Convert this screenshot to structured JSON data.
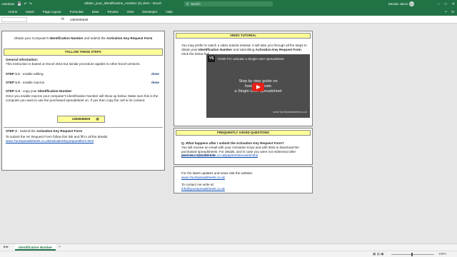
{
  "window": {
    "autosave": "AutoSave",
    "title": "obtain_your_identification_number (2).xlsm  -  Excel",
    "search_placeholder": "Search",
    "user": "Damian Jancic",
    "user_initials": "DJ"
  },
  "ribbon": {
    "tabs": [
      "Home",
      "Insert",
      "Page Layout",
      "Formulas",
      "Data",
      "Review",
      "View",
      "Developer",
      "Help"
    ]
  },
  "formula_bar": {
    "fx": "fx",
    "value": "1353635625"
  },
  "left_panel": {
    "intro_pre": "Obtain your Computer's ",
    "intro_b1": "Identification Number",
    "intro_mid": " and submit the ",
    "intro_b2": "Activation Key Request Form",
    "steps_header": "FOLLOW THESE STEPS",
    "general_title": "General information:",
    "general_text": "This instruction is based on Excel 2016 but similar procedure applies to other Excel versions.",
    "step_1_1_label": "STEP 1-1",
    "step_1_1_text": " - enable editing",
    "step_1_1_status": "done",
    "step_1_2_label": "STEP 1-2",
    "step_1_2_text": " - enable macros",
    "step_1_2_status": "done",
    "step_1_3_label": "STEP 1-3",
    "step_1_3_text_pre": " - copy your ",
    "step_1_3_text_b": "Identification Number",
    "note": "Once you enable macros your computer's Identification Number will show up below. Make sure this is the computer you want to use the purchased spreadsheet on. If yes then copy the cell or its content:",
    "id_number": "1353635625",
    "step_2_label": "STEP 2",
    "step_2_text_pre": " - Submit the ",
    "step_2_text_b": "Activation Key Request Form",
    "step_2_instructions": "To submit the AK Request Form follow this link and fill in all the details:",
    "step_2_link": "www.YourSpreadsheets.co.uk/activationkeyrequestform.html"
  },
  "video_panel": {
    "header": "VIDEO TUTORIAL",
    "text_1": "You may prefer to watch a video tutorial instead. It will take you through all the steps to obtain your ",
    "text_b1": "Identification Number",
    "text_2": " and submitting ",
    "text_b2": "Activation Key Request Form",
    "text_3": ". Click the below link.",
    "player_logo": "YS",
    "player_title": "HOW TO: activate a Single-User spreadsheet",
    "overlay_line1": "Step by step guide on",
    "overlay_line2": "how to activate",
    "overlay_line3": "a Single-User spreadsheet",
    "player_caption": "www.YourSpreadsheets.co.uk"
  },
  "faq_panel": {
    "header": "FREQUENTLY ASKED QUESTIONS",
    "question": "Q. What happens after I submit the Activation Key Request Form?",
    "answer": "You will receive an email with your Activation Keys and with links to download the purchased spreadsheets. For details, and in case you were not redirected after purchase, click this link:",
    "link": "www.YourSpreadsheets.co.uk/paymentreceived.html"
  },
  "contact_panel": {
    "updates_text": "For the latest updates and news visit the website:",
    "website": "www.YourSpreadsheets.co.uk",
    "contact_text": "To contact me write at:",
    "email": "info@yourspreadsheets.co.uk"
  },
  "sheet_tabs": {
    "active": "Identification Number",
    "add": "+"
  },
  "status_bar": {
    "zoom": "100%"
  }
}
